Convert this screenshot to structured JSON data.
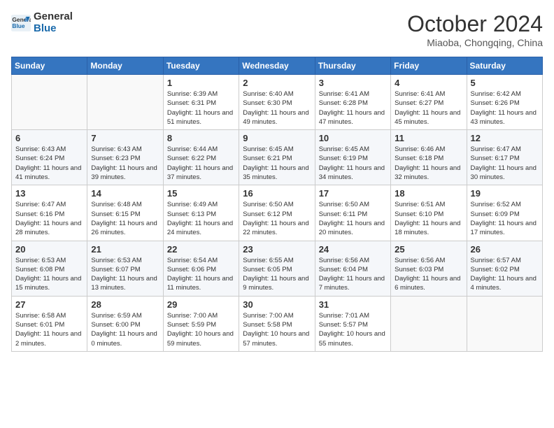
{
  "header": {
    "logo_line1": "General",
    "logo_line2": "Blue",
    "month": "October 2024",
    "location": "Miaoba, Chongqing, China"
  },
  "weekdays": [
    "Sunday",
    "Monday",
    "Tuesday",
    "Wednesday",
    "Thursday",
    "Friday",
    "Saturday"
  ],
  "weeks": [
    [
      {
        "day": "",
        "info": ""
      },
      {
        "day": "",
        "info": ""
      },
      {
        "day": "1",
        "info": "Sunrise: 6:39 AM\nSunset: 6:31 PM\nDaylight: 11 hours and 51 minutes."
      },
      {
        "day": "2",
        "info": "Sunrise: 6:40 AM\nSunset: 6:30 PM\nDaylight: 11 hours and 49 minutes."
      },
      {
        "day": "3",
        "info": "Sunrise: 6:41 AM\nSunset: 6:28 PM\nDaylight: 11 hours and 47 minutes."
      },
      {
        "day": "4",
        "info": "Sunrise: 6:41 AM\nSunset: 6:27 PM\nDaylight: 11 hours and 45 minutes."
      },
      {
        "day": "5",
        "info": "Sunrise: 6:42 AM\nSunset: 6:26 PM\nDaylight: 11 hours and 43 minutes."
      }
    ],
    [
      {
        "day": "6",
        "info": "Sunrise: 6:43 AM\nSunset: 6:24 PM\nDaylight: 11 hours and 41 minutes."
      },
      {
        "day": "7",
        "info": "Sunrise: 6:43 AM\nSunset: 6:23 PM\nDaylight: 11 hours and 39 minutes."
      },
      {
        "day": "8",
        "info": "Sunrise: 6:44 AM\nSunset: 6:22 PM\nDaylight: 11 hours and 37 minutes."
      },
      {
        "day": "9",
        "info": "Sunrise: 6:45 AM\nSunset: 6:21 PM\nDaylight: 11 hours and 35 minutes."
      },
      {
        "day": "10",
        "info": "Sunrise: 6:45 AM\nSunset: 6:19 PM\nDaylight: 11 hours and 34 minutes."
      },
      {
        "day": "11",
        "info": "Sunrise: 6:46 AM\nSunset: 6:18 PM\nDaylight: 11 hours and 32 minutes."
      },
      {
        "day": "12",
        "info": "Sunrise: 6:47 AM\nSunset: 6:17 PM\nDaylight: 11 hours and 30 minutes."
      }
    ],
    [
      {
        "day": "13",
        "info": "Sunrise: 6:47 AM\nSunset: 6:16 PM\nDaylight: 11 hours and 28 minutes."
      },
      {
        "day": "14",
        "info": "Sunrise: 6:48 AM\nSunset: 6:15 PM\nDaylight: 11 hours and 26 minutes."
      },
      {
        "day": "15",
        "info": "Sunrise: 6:49 AM\nSunset: 6:13 PM\nDaylight: 11 hours and 24 minutes."
      },
      {
        "day": "16",
        "info": "Sunrise: 6:50 AM\nSunset: 6:12 PM\nDaylight: 11 hours and 22 minutes."
      },
      {
        "day": "17",
        "info": "Sunrise: 6:50 AM\nSunset: 6:11 PM\nDaylight: 11 hours and 20 minutes."
      },
      {
        "day": "18",
        "info": "Sunrise: 6:51 AM\nSunset: 6:10 PM\nDaylight: 11 hours and 18 minutes."
      },
      {
        "day": "19",
        "info": "Sunrise: 6:52 AM\nSunset: 6:09 PM\nDaylight: 11 hours and 17 minutes."
      }
    ],
    [
      {
        "day": "20",
        "info": "Sunrise: 6:53 AM\nSunset: 6:08 PM\nDaylight: 11 hours and 15 minutes."
      },
      {
        "day": "21",
        "info": "Sunrise: 6:53 AM\nSunset: 6:07 PM\nDaylight: 11 hours and 13 minutes."
      },
      {
        "day": "22",
        "info": "Sunrise: 6:54 AM\nSunset: 6:06 PM\nDaylight: 11 hours and 11 minutes."
      },
      {
        "day": "23",
        "info": "Sunrise: 6:55 AM\nSunset: 6:05 PM\nDaylight: 11 hours and 9 minutes."
      },
      {
        "day": "24",
        "info": "Sunrise: 6:56 AM\nSunset: 6:04 PM\nDaylight: 11 hours and 7 minutes."
      },
      {
        "day": "25",
        "info": "Sunrise: 6:56 AM\nSunset: 6:03 PM\nDaylight: 11 hours and 6 minutes."
      },
      {
        "day": "26",
        "info": "Sunrise: 6:57 AM\nSunset: 6:02 PM\nDaylight: 11 hours and 4 minutes."
      }
    ],
    [
      {
        "day": "27",
        "info": "Sunrise: 6:58 AM\nSunset: 6:01 PM\nDaylight: 11 hours and 2 minutes."
      },
      {
        "day": "28",
        "info": "Sunrise: 6:59 AM\nSunset: 6:00 PM\nDaylight: 11 hours and 0 minutes."
      },
      {
        "day": "29",
        "info": "Sunrise: 7:00 AM\nSunset: 5:59 PM\nDaylight: 10 hours and 59 minutes."
      },
      {
        "day": "30",
        "info": "Sunrise: 7:00 AM\nSunset: 5:58 PM\nDaylight: 10 hours and 57 minutes."
      },
      {
        "day": "31",
        "info": "Sunrise: 7:01 AM\nSunset: 5:57 PM\nDaylight: 10 hours and 55 minutes."
      },
      {
        "day": "",
        "info": ""
      },
      {
        "day": "",
        "info": ""
      }
    ]
  ]
}
